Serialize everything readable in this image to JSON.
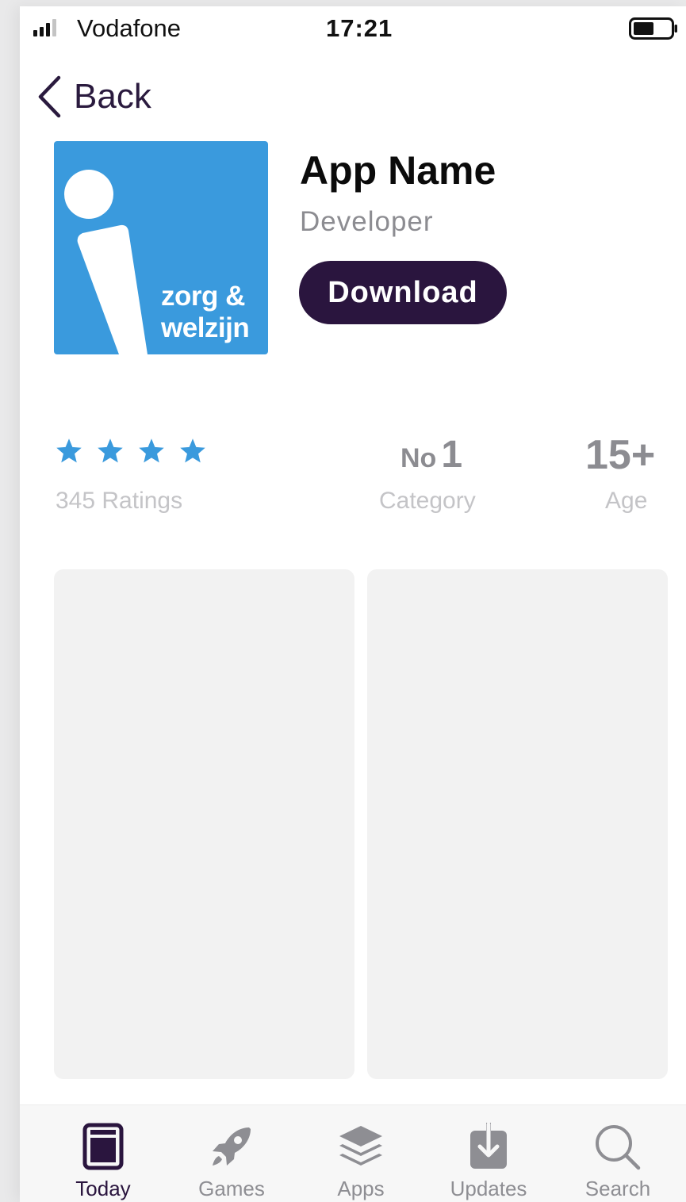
{
  "status_bar": {
    "carrier": "Vodafone",
    "time": "17:21",
    "signal_bars": 3,
    "signal_bars_total": 4,
    "battery_level": 0.5
  },
  "nav": {
    "back_label": "Back",
    "back_icon": "chevron-left-icon"
  },
  "app": {
    "name": "App Name",
    "developer": "Developer",
    "download_label": "Download",
    "icon": {
      "text_line1": "zorg &",
      "text_line2": "welzijn",
      "bg_color": "#3a9add"
    }
  },
  "stats": {
    "stars": 4,
    "ratings_label": "345 Ratings",
    "rank_prefix": "No",
    "rank_number": "1",
    "category_label": "Category",
    "age_value": "15+",
    "age_label": "Age"
  },
  "tabs": [
    {
      "label": "Today",
      "icon": "today-icon",
      "active": true
    },
    {
      "label": "Games",
      "icon": "rocket-icon",
      "active": false
    },
    {
      "label": "Apps",
      "icon": "layers-icon",
      "active": false
    },
    {
      "label": "Updates",
      "icon": "download-tray-icon",
      "active": false
    },
    {
      "label": "Search",
      "icon": "search-icon",
      "active": false
    }
  ],
  "colors": {
    "accent_dark": "#2a153e",
    "star_blue": "#3a9add",
    "muted_gray": "#8e8e93"
  }
}
